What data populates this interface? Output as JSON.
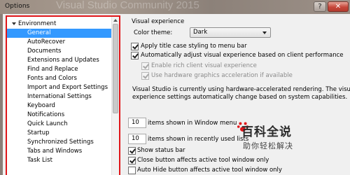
{
  "window": {
    "title": "Options",
    "background_title": "Visual Studio Community 2015",
    "help_label": "?",
    "close_label": "✕"
  },
  "tree": {
    "group_label": "Environment",
    "items": [
      {
        "label": "General",
        "selected": true
      },
      {
        "label": "AutoRecover"
      },
      {
        "label": "Documents"
      },
      {
        "label": "Extensions and Updates"
      },
      {
        "label": "Find and Replace"
      },
      {
        "label": "Fonts and Colors"
      },
      {
        "label": "Import and Export Settings"
      },
      {
        "label": "International Settings"
      },
      {
        "label": "Keyboard"
      },
      {
        "label": "Notifications"
      },
      {
        "label": "Quick Launch"
      },
      {
        "label": "Startup"
      },
      {
        "label": "Synchronized Settings"
      },
      {
        "label": "Tabs and Windows"
      },
      {
        "label": "Task List"
      }
    ]
  },
  "general": {
    "section_title": "Visual experience",
    "color_theme_label": "Color theme:",
    "color_theme_value": "Dark",
    "apply_title_case": "Apply title case styling to menu bar",
    "auto_adjust": "Automatically adjust visual experience based on client performance",
    "enable_rich": "Enable rich client visual experience",
    "use_hw_accel": "Use hardware graphics acceleration if available",
    "info_line1": "Visual Studio is currently using hardware-accelerated rendering. The visual",
    "info_line2": "experience settings automatically change based on system capabilities.",
    "window_menu_count": "10",
    "window_menu_label": "items shown in Window menu",
    "recent_count": "10",
    "recent_label": "items shown in recently used lists",
    "show_status_bar": "Show status bar",
    "close_button_label": "Close button affects active tool window only",
    "auto_hide_label": "Auto Hide button affects active tool window only"
  },
  "watermark": {
    "main": "百科全说",
    "sub": "助你轻松解决"
  },
  "colors": {
    "selection": "#3399ff",
    "highlight_border": "#e0161a"
  }
}
